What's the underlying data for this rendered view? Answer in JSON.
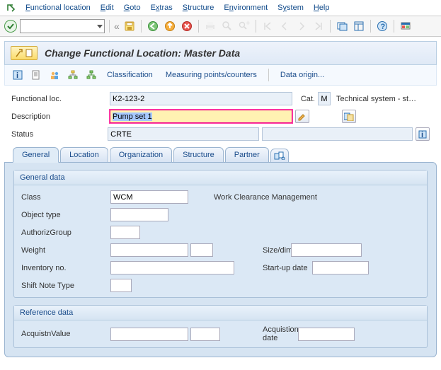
{
  "menu": {
    "items": [
      {
        "label": "Functional location",
        "u": "F"
      },
      {
        "label": "Edit",
        "u": "E"
      },
      {
        "label": "Goto",
        "u": "G"
      },
      {
        "label": "Extras",
        "u": "x",
        "uidx": 1
      },
      {
        "label": "Structure",
        "u": "S"
      },
      {
        "label": "Environment",
        "u": "n",
        "uidx": 1
      },
      {
        "label": "System",
        "u": "y",
        "uidx": 1
      },
      {
        "label": "Help",
        "u": "H"
      }
    ]
  },
  "title": "Change Functional Location: Master Data",
  "subtoolbar": {
    "classification": "Classification",
    "measuring": "Measuring points/counters",
    "dataorigin": "Data origin..."
  },
  "header": {
    "func_loc_lbl": "Functional loc.",
    "func_loc_val": "K2-123-2",
    "cat_lbl": "Cat.",
    "cat_val": "M",
    "cat_text": "Technical system - st…",
    "desc_lbl": "Description",
    "desc_val": "Pump set 1",
    "status_lbl": "Status",
    "status_val": "CRTE"
  },
  "tabs": [
    "General",
    "Location",
    "Organization",
    "Structure",
    "Partner"
  ],
  "general_group": {
    "title": "General data",
    "class_lbl": "Class",
    "class_val": "WCM",
    "class_text": "Work Clearance Management",
    "objtype_lbl": "Object type",
    "authgrp_lbl": "AuthorizGroup",
    "weight_lbl": "Weight",
    "size_lbl": "Size/dimension",
    "inv_lbl": "Inventory no.",
    "startup_lbl": "Start-up date",
    "shift_lbl": "Shift Note Type"
  },
  "reference_group": {
    "title": "Reference data",
    "acqval_lbl": "AcquistnValue",
    "acqdate_lbl": "Acquistion date"
  }
}
